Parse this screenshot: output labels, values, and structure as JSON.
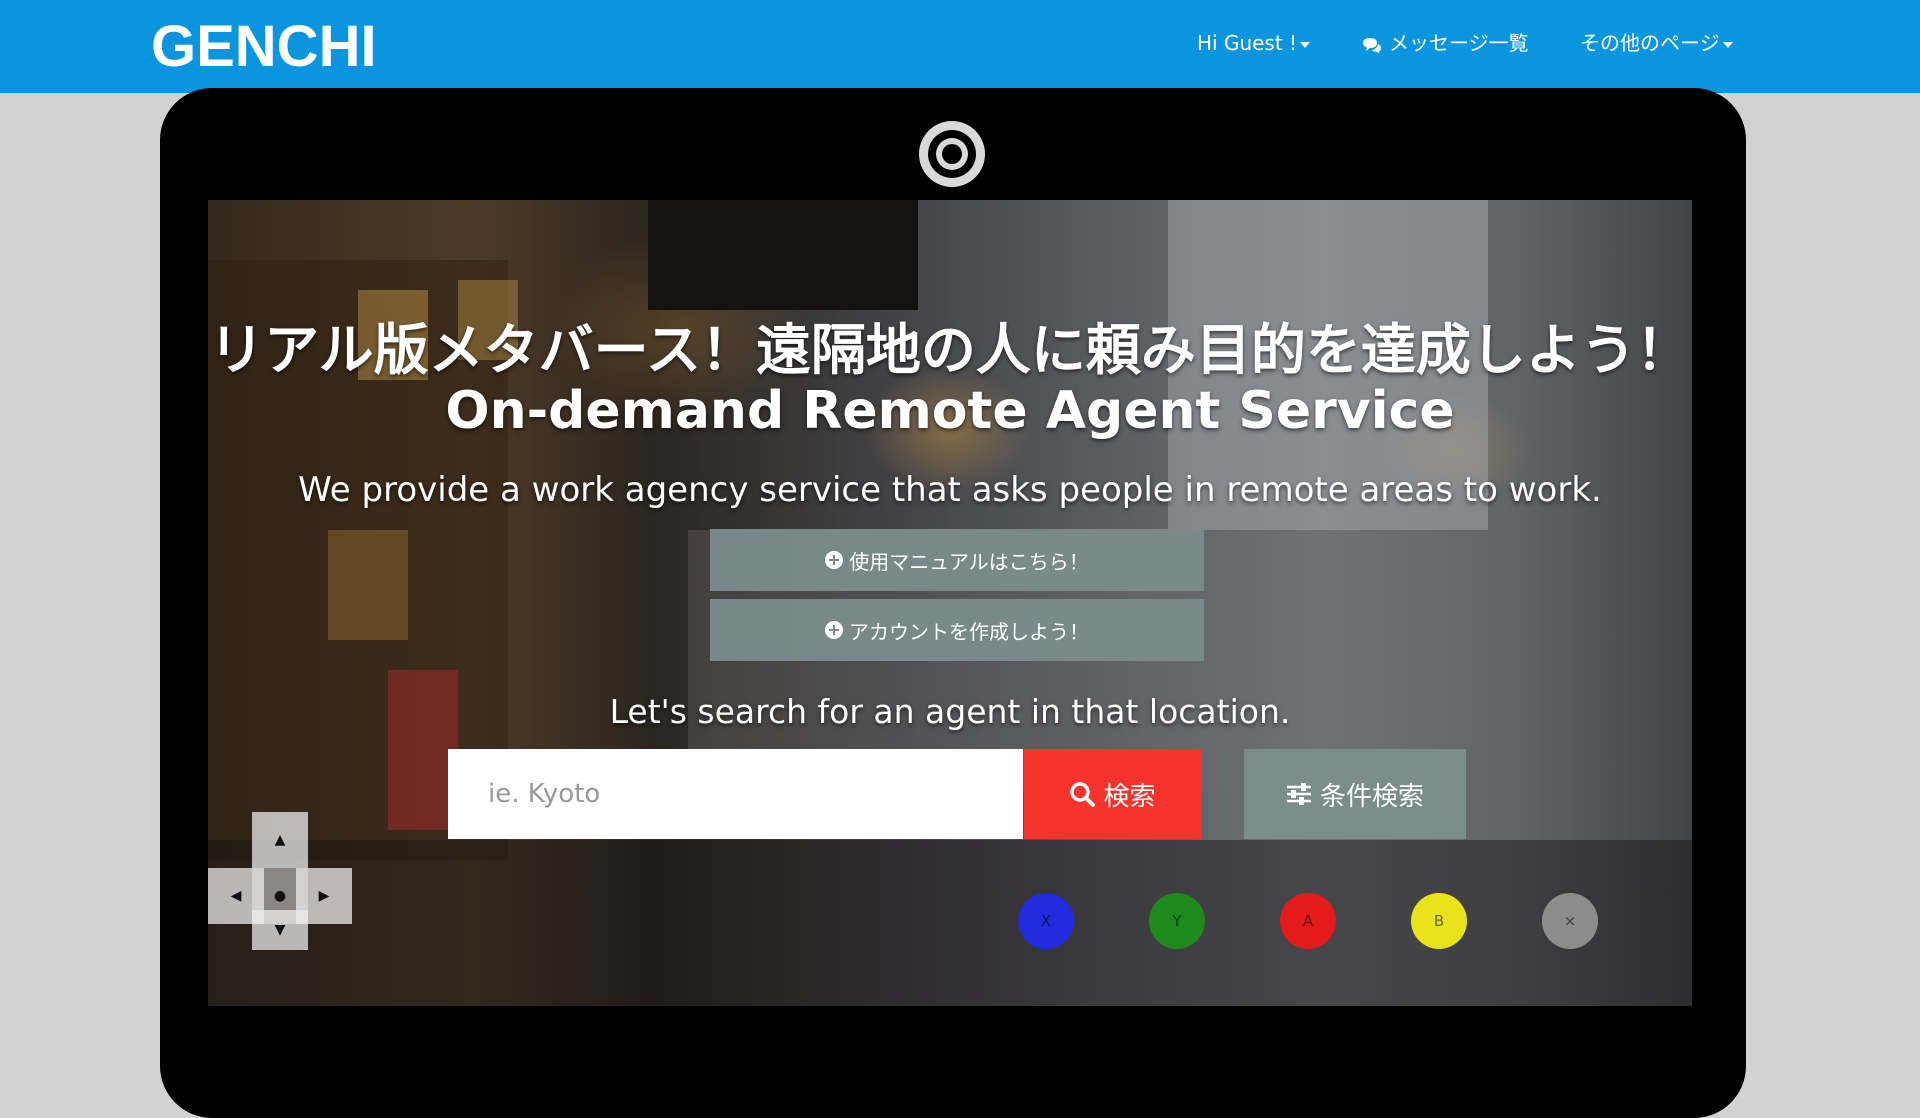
{
  "navbar": {
    "brand": "GENCHI",
    "greeting": "Hi Guest !",
    "messages_label": "メッセージ一覧",
    "other_pages_label": "その他のページ"
  },
  "hero": {
    "title_jp": "リアル版メタバース！遠隔地の人に頼み目的を達成しよう！",
    "title_en": "On-demand Remote Agent Service",
    "subtitle": "We provide a work agency service that asks people in remote areas to work.",
    "manual_button": "使用マニュアルはこちら！",
    "signup_button": "アカウントを作成しよう！",
    "search_hint": "Let's search for an agent in that location.",
    "search_placeholder": "ie. Kyoto",
    "search_button": "検索",
    "filter_button": "条件検索"
  },
  "controller": {
    "dpad_up": "▲",
    "dpad_left": "◀",
    "dpad_right": "▶",
    "dpad_down": "▼",
    "btn_x": "X",
    "btn_y": "Y",
    "btn_a": "A",
    "btn_b": "B",
    "btn_close": "×",
    "colors": {
      "x": "#1f2bdc",
      "y": "#1e8a1e",
      "a": "#e31b1b",
      "b": "#e8e31a",
      "close": "#8c8c8c"
    }
  },
  "theme": {
    "navbar_bg": "#0b95df",
    "search_red": "#f4332c",
    "button_gray": "#7b8c8e"
  }
}
